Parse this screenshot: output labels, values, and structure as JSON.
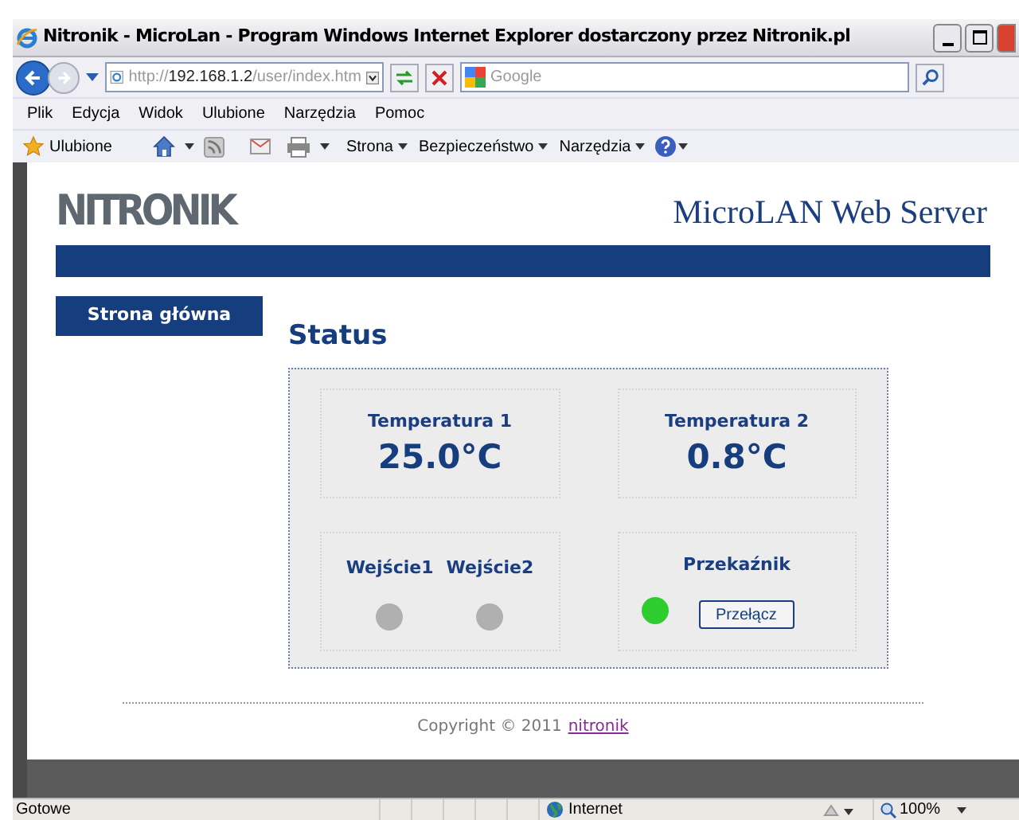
{
  "window": {
    "title": "Nitronik - MicroLan - Program Windows Internet Explorer dostarczony przez Nitronik.pl"
  },
  "address": {
    "scheme": "http://",
    "host": "192.168.1.2",
    "path": "/user/index.htm"
  },
  "search": {
    "placeholder": "Google"
  },
  "menu": [
    "Plik",
    "Edycja",
    "Widok",
    "Ulubione",
    "Narzędzia",
    "Pomoc"
  ],
  "favorites_bar": {
    "favorites": "Ulubione",
    "commands": [
      "Strona",
      "Bezpieczeństwo",
      "Narzędzia"
    ]
  },
  "page": {
    "logo": "NITRONIK",
    "header_title": "MicroLAN Web Server",
    "nav": [
      "Strona główna"
    ],
    "heading": "Status",
    "temperatures": [
      {
        "label": "Temperatura 1",
        "value": "25.0°C"
      },
      {
        "label": "Temperatura 2",
        "value": "0.8°C"
      }
    ],
    "inputs": [
      {
        "label": "Wejście1",
        "on": false
      },
      {
        "label": "Wejście2",
        "on": false
      }
    ],
    "relay": {
      "label": "Przekaźnik",
      "on": true,
      "button": "Przełącz"
    },
    "footer": {
      "text": "Copyright © 2011",
      "link": "nitronik"
    }
  },
  "status_bar": {
    "text": "Gotowe",
    "zone": "Internet",
    "zoom": "100%"
  }
}
